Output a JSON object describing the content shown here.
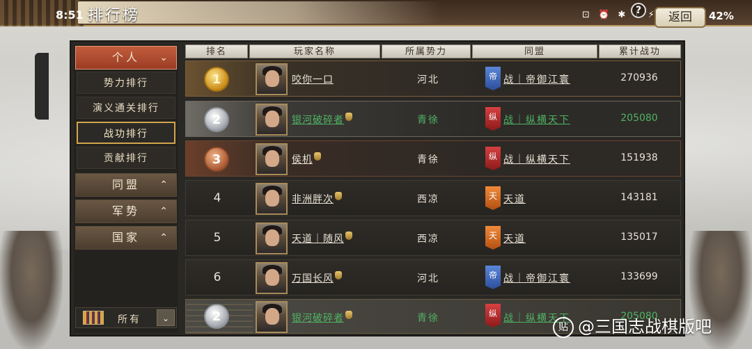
{
  "status": {
    "time": "8:51",
    "icons": "⊡ ⏰ ✱ ♪ ⚡ ▲ ▮",
    "battery": "42%"
  },
  "header": {
    "title": "排行榜",
    "help": "?",
    "back": "返回"
  },
  "sidebar": {
    "categories": [
      {
        "label": "个人",
        "chevron": "⌄"
      },
      {
        "label": "同盟",
        "chevron": "⌃"
      },
      {
        "label": "军势",
        "chevron": "⌃"
      },
      {
        "label": "国家",
        "chevron": "⌃"
      }
    ],
    "subitems": [
      "势力排行",
      "演义通关排行",
      "战功排行",
      "贡献排行"
    ],
    "filter": {
      "label": "所有",
      "dropdown": "⌄"
    }
  },
  "table": {
    "headers": [
      "排名",
      "玩家名称",
      "所属势力",
      "同盟",
      "累计战功"
    ],
    "rows": [
      {
        "rank": "1",
        "name": "咬你一口",
        "region": "河北",
        "banner": "帝",
        "alliance": "战｜帝御江寰",
        "merit": "270936"
      },
      {
        "rank": "2",
        "name": "银河破碎者",
        "region": "青徐",
        "banner": "纵",
        "alliance": "战｜纵横天下",
        "merit": "205080"
      },
      {
        "rank": "3",
        "name": "侯机",
        "region": "青徐",
        "banner": "纵",
        "alliance": "战｜纵横天下",
        "merit": "151938"
      },
      {
        "rank": "4",
        "name": "非洲胖次",
        "region": "西凉",
        "banner": "天",
        "alliance": "天道",
        "merit": "143181"
      },
      {
        "rank": "5",
        "name": "天道｜随风",
        "region": "西凉",
        "banner": "天",
        "alliance": "天道",
        "merit": "135017"
      },
      {
        "rank": "6",
        "name": "万国长风",
        "region": "河北",
        "banner": "帝",
        "alliance": "战｜帝御江寰",
        "merit": "133699"
      },
      {
        "rank": "2",
        "name": "银河破碎者",
        "region": "青徐",
        "banner": "纵",
        "alliance": "战｜纵横天下",
        "merit": "205080"
      }
    ]
  },
  "colors": {
    "highlight_green": "#4fb364",
    "active_tab": "#b0482c",
    "selected_border": "#d2a64d"
  },
  "watermark": {
    "icon": "贴",
    "text": "@三国志战棋版吧"
  }
}
